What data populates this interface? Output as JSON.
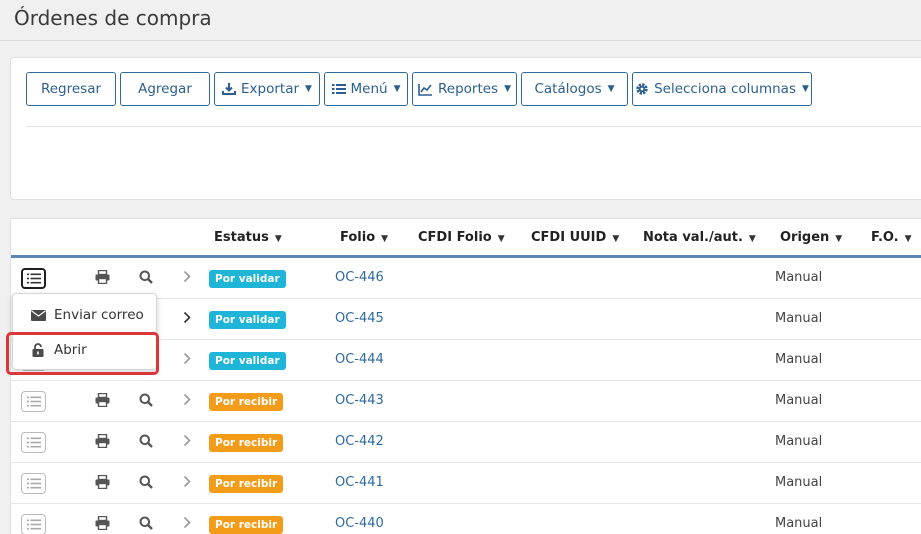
{
  "page": {
    "title": "Órdenes de compra"
  },
  "toolbar": {
    "back_label": "Regresar",
    "add_label": "Agregar",
    "export_label": "Exportar",
    "menu_label": "Menú",
    "reports_label": "Reportes",
    "catalogs_label": "Catálogos",
    "columns_label": "Selecciona columnas"
  },
  "table": {
    "headers": {
      "estatus": "Estatus",
      "folio": "Folio",
      "cfdi_folio": "CFDI Folio",
      "cfdi_uuid": "CFDI UUID",
      "nota": "Nota val./aut.",
      "origen": "Origen",
      "fo": "F.O."
    },
    "rows": [
      {
        "status": "Por validar",
        "folio": "OC-446",
        "origen": "Manual"
      },
      {
        "status": "Por validar",
        "folio": "OC-445",
        "origen": "Manual"
      },
      {
        "status": "Por validar",
        "folio": "OC-444",
        "origen": "Manual"
      },
      {
        "status": "Por recibir",
        "folio": "OC-443",
        "origen": "Manual"
      },
      {
        "status": "Por recibir",
        "folio": "OC-442",
        "origen": "Manual"
      },
      {
        "status": "Por recibir",
        "folio": "OC-441",
        "origen": "Manual"
      },
      {
        "status": "Por recibir",
        "folio": "OC-440",
        "origen": "Manual"
      }
    ]
  },
  "dropdown": {
    "send_email_label": "Enviar correo",
    "open_label": "Abrir"
  },
  "colors": {
    "por_validar": "#1fb5d8",
    "por_recibir": "#f39c1a",
    "accent": "#2c6aa0",
    "highlight": "#d9383a"
  }
}
